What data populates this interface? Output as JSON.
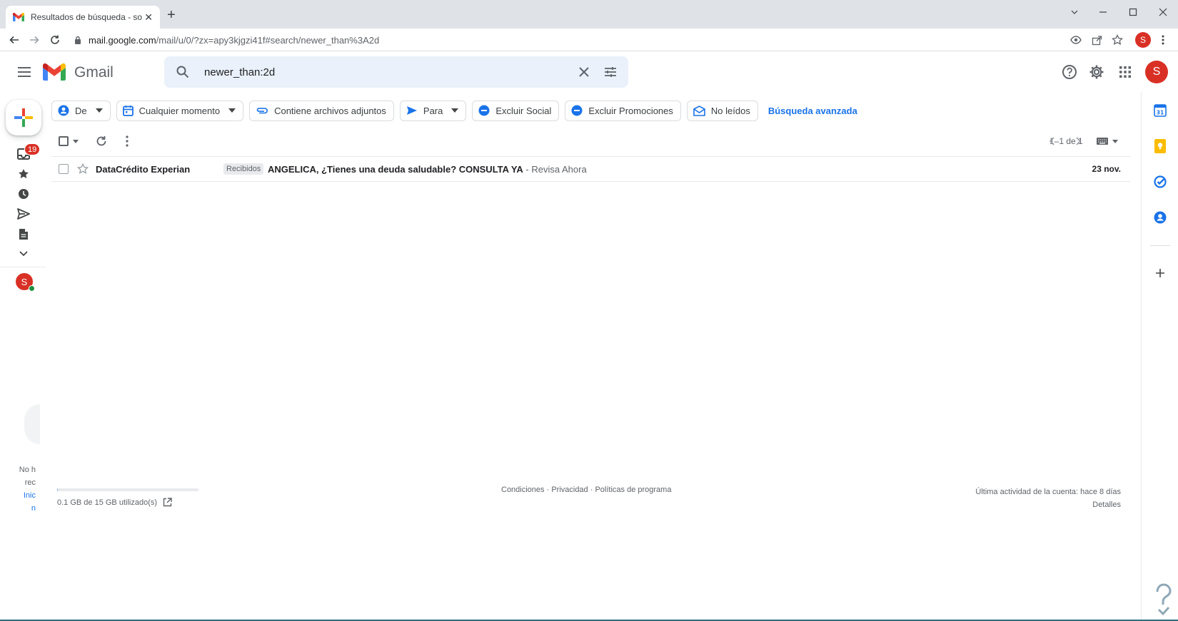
{
  "browser": {
    "tab_title": "Resultados de búsqueda - solvetic",
    "url_host": "mail.google.com",
    "url_path": "/mail/u/0/?zx=apy3kjgzi41f#search/newer_than%3A2d",
    "profile_initial": "S"
  },
  "header": {
    "app_name": "Gmail",
    "search_value": "newer_than:2d",
    "avatar_initial": "S"
  },
  "rail": {
    "inbox_badge": "19",
    "avatar_initial": "S",
    "cut_text_1": "No h",
    "cut_text_2": "rec",
    "cut_link_1": "Inic",
    "cut_link_2": "n"
  },
  "chips": {
    "from": "De",
    "any_time": "Cualquier momento",
    "has_attachment": "Contiene archivos adjuntos",
    "to": "Para",
    "exclude_social": "Excluir Social",
    "exclude_promos": "Excluir Promociones",
    "unread": "No leídos",
    "advanced": "Búsqueda avanzada"
  },
  "list": {
    "pager": "1–1 de 1",
    "messages": [
      {
        "sender": "DataCrédito Experian",
        "label": "Recibidos",
        "subject": "ANGELICA, ¿Tienes una deuda saludable? CONSULTA YA",
        "snippet": " - Revisa Ahora",
        "date": "23 nov."
      }
    ]
  },
  "footer": {
    "storage": "0.1 GB de 15 GB utilizado(s)",
    "storage_fraction": 0.0067,
    "links": "Condiciones · Privacidad · Políticas de programa",
    "last_activity": "Última actividad de la cuenta: hace 8 días",
    "details": "Detalles"
  },
  "colors": {
    "gmail_red": "#ea4335",
    "accent_blue": "#1a73e8",
    "avatar_red": "#d93025"
  },
  "icons": {
    "rail": [
      "inbox-icon",
      "star-icon",
      "clock-icon",
      "send-icon",
      "draft-icon",
      "chevron-down-icon"
    ],
    "right_panel": [
      "calendar-icon",
      "keep-icon",
      "tasks-icon",
      "contacts-icon",
      "plus-icon"
    ]
  }
}
